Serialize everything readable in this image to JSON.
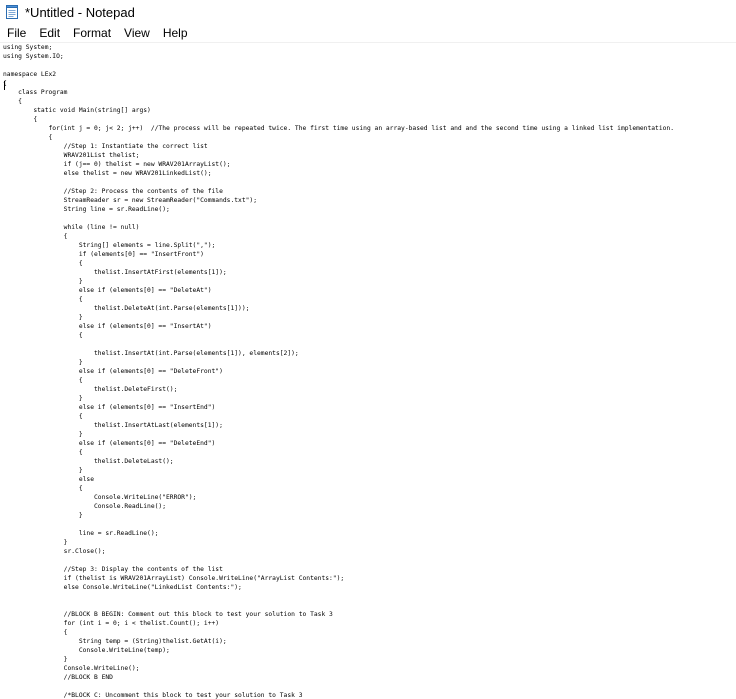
{
  "window": {
    "title": "*Untitled - Notepad"
  },
  "menu": {
    "items": [
      {
        "id": "file",
        "label": "File"
      },
      {
        "id": "edit",
        "label": "Edit"
      },
      {
        "id": "format",
        "label": "Format"
      },
      {
        "id": "view",
        "label": "View"
      },
      {
        "id": "help",
        "label": "Help"
      }
    ]
  },
  "editor": {
    "text": "using System;\nusing System.IO;\n\nnamespace LEx2\n{\n    class Program\n    {\n        static void Main(string[] args)\n        {\n            for(int j = 0; j< 2; j++)  //The process will be repeated twice. The first time using an array-based list and and the second time using a linked list implementation.\n            {\n                //Step 1: Instantiate the correct list\n                WRAV201List thelist;\n                if (j== 0) thelist = new WRAV201ArrayList();\n                else thelist = new WRAV201LinkedList();\n\n                //Step 2: Process the contents of the file\n                StreamReader sr = new StreamReader(\"Commands.txt\");\n                String line = sr.ReadLine();\n\n                while (line != null)\n                {\n                    String[] elements = line.Split(\",\");\n                    if (elements[0] == \"InsertFront\")\n                    {\n                        thelist.InsertAtFirst(elements[1]);\n                    }\n                    else if (elements[0] == \"DeleteAt\")\n                    {\n                        thelist.DeleteAt(int.Parse(elements[1]));\n                    }\n                    else if (elements[0] == \"InsertAt\")\n                    {\n\n                        thelist.InsertAt(int.Parse(elements[1]), elements[2]);\n                    }\n                    else if (elements[0] == \"DeleteFront\")\n                    {\n                        thelist.DeleteFirst();\n                    }\n                    else if (elements[0] == \"InsertEnd\")\n                    {\n                        thelist.InsertAtLast(elements[1]);\n                    }\n                    else if (elements[0] == \"DeleteEnd\")\n                    {\n                        thelist.DeleteLast();\n                    }\n                    else\n                    {\n                        Console.WriteLine(\"ERROR\");\n                        Console.ReadLine();\n                    }\n\n                    line = sr.ReadLine();\n                }\n                sr.Close();\n\n                //Step 3: Display the contents of the list\n                if (thelist is WRAV201ArrayList) Console.WriteLine(\"ArrayList Contents:\");\n                else Console.WriteLine(\"LinkedList Contents:\");\n\n\n                //BLOCK B BEGIN: Comment out this block to test your solution to Task 3\n                for (int i = 0; i < thelist.Count(); i++)\n                {\n                    String temp = (String)thelist.GetAt(i);\n                    Console.WriteLine(temp);\n                }\n                Console.WriteLine();\n                //BLOCK B END\n\n                /*BLOCK C: Uncomment this block to test your solution to Task 3"
  },
  "colors": {
    "background": "#ffffff",
    "text": "#000000"
  },
  "icons": {
    "app": "notepad-icon"
  }
}
